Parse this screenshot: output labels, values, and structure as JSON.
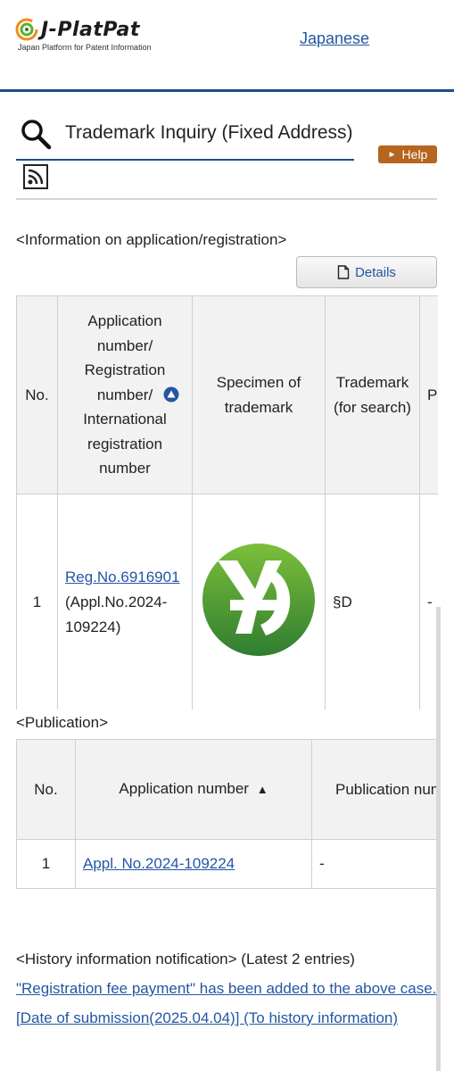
{
  "header": {
    "logo_text": "J-PlatPat",
    "logo_subtitle": "Japan Platform for Patent Information",
    "language_link": "Japanese"
  },
  "title": {
    "text": "Trademark Inquiry (Fixed Address)",
    "help_label": "Help"
  },
  "app_info": {
    "heading": "<Information on application/registration>",
    "details_label": "Details",
    "columns": {
      "no": "No.",
      "app_number": "Application number/ Registration number/ International registration number",
      "specimen": "Specimen of trademark",
      "trademark_search": "Trademark (for search)",
      "partial": "P"
    },
    "rows": [
      {
        "no": "1",
        "reg_link": "Reg.No.6916901",
        "appl_text": "(Appl.No.2024-109224)",
        "trademark_search": "§D",
        "partial": "-"
      }
    ]
  },
  "publication": {
    "heading": "<Publication>",
    "columns": {
      "no": "No.",
      "app_number": "Application number",
      "pub_number": "Publication number of examined application"
    },
    "rows": [
      {
        "no": "1",
        "app_link": "Appl. No.2024-109224",
        "pub_number": "-"
      }
    ]
  },
  "history": {
    "heading": "<History information notification>",
    "count_text": "(Latest 2 entries)",
    "link_text": "\"Registration fee payment\" has been added to the above case. [Date of submission(2025.04.04)] (To history information)"
  },
  "colors": {
    "accent": "#1f4e8c",
    "link": "#2456a4",
    "help_button": "#b5651d",
    "specimen_green": "#4f9a2c"
  }
}
